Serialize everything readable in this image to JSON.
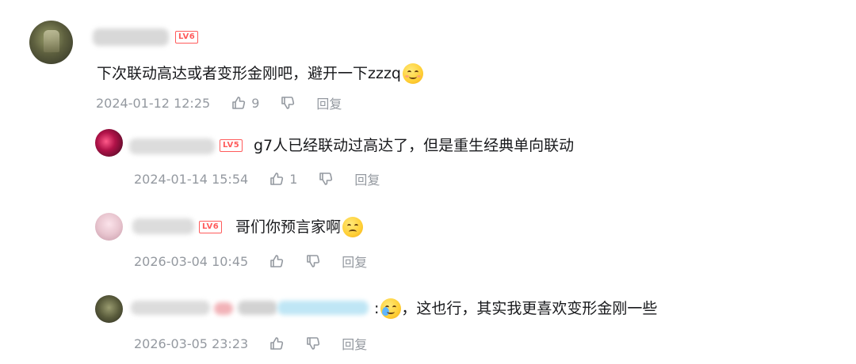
{
  "comments": [
    {
      "level": "LV6",
      "text": "下次联动高达或者变形金刚吧，避开一下zzzq",
      "emoji": "smile-emoji",
      "date": "2024-01-12 12:25",
      "likes": "9",
      "reply_label": "回复"
    },
    {
      "level": "LV5",
      "text": "g7人已经联动过高达了，但是重生经典单向联动",
      "date": "2024-01-14 15:54",
      "likes": "1",
      "reply_label": "回复"
    },
    {
      "level": "LV6",
      "text": "哥们你预言家啊",
      "emoji": "doubt-emoji",
      "date": "2026-03-04 10:45",
      "likes": "",
      "reply_label": "回复"
    },
    {
      "text_prefix": ":",
      "text": "，这也行，其实我更喜欢变形金刚一些",
      "emoji": "cry-emoji",
      "date": "2026-03-05 23:23",
      "likes": "",
      "reply_label": "回复"
    }
  ],
  "colors": {
    "level_badge": "#ff5b5b",
    "meta_text": "#9499a0",
    "comment_text": "#18191c"
  }
}
